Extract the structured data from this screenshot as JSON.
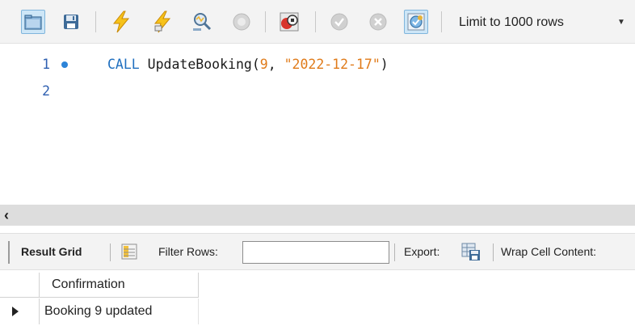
{
  "toolbar": {
    "buttons": [
      {
        "name": "open-sql-file-icon"
      },
      {
        "name": "save-script-icon"
      },
      {
        "name": "execute-lightning-icon"
      },
      {
        "name": "execute-current-lightning-icon"
      },
      {
        "name": "explain-magnifier-icon"
      },
      {
        "name": "stop-execution-icon"
      },
      {
        "name": "stop-on-error-toggle-icon"
      },
      {
        "name": "autocommit-check-icon"
      },
      {
        "name": "rollback-icon"
      },
      {
        "name": "beautify-toggle-icon"
      }
    ],
    "limit_select": {
      "value": "Limit to 1000 rows"
    }
  },
  "editor": {
    "lines": [
      {
        "number": "1",
        "has_marker": true,
        "tokens": [
          {
            "type": "kw",
            "text": "CALL"
          },
          {
            "type": "fn",
            "text": " UpdateBooking"
          },
          {
            "type": "punc",
            "text": "("
          },
          {
            "type": "num",
            "text": "9"
          },
          {
            "type": "punc",
            "text": ", "
          },
          {
            "type": "str",
            "text": "\"2022-12-17\""
          },
          {
            "type": "punc",
            "text": ")"
          }
        ]
      },
      {
        "number": "2",
        "has_marker": false,
        "tokens": []
      }
    ]
  },
  "results_toolbar": {
    "result_grid_label": "Result Grid",
    "filter_rows_label": "Filter Rows:",
    "filter_rows_value": "",
    "export_label": "Export:",
    "wrap_label": "Wrap Cell Content:"
  },
  "grid": {
    "columns": [
      "Confirmation"
    ],
    "rows": [
      [
        "Booking 9 updated"
      ]
    ]
  }
}
